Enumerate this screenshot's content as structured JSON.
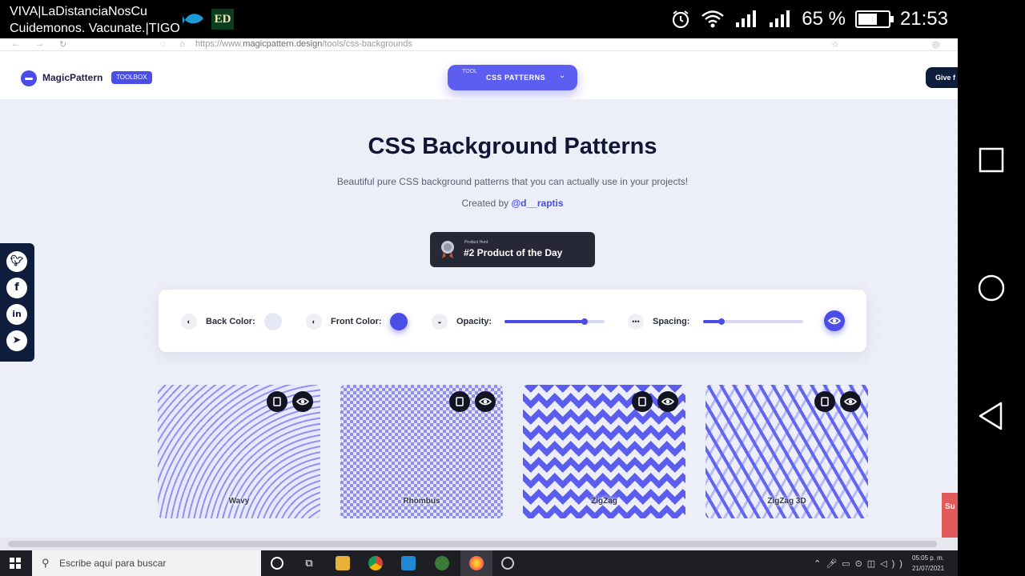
{
  "status_bar": {
    "carrier_line1": "VIVA|LaDistanciaNosCu",
    "carrier_line2": "Cuidemonos. Vacunate.|TIGO",
    "app2_label": "ED",
    "battery_percent": "65 %",
    "battery_level": 0.65,
    "time": "21:53",
    "icons": [
      "app-fish-icon",
      "app-ed-icon",
      "alarm-icon",
      "wifi-icon",
      "signal-icon",
      "signal-icon",
      "battery-icon"
    ]
  },
  "nav_bar": {
    "icons": [
      "recents-square-icon",
      "home-circle-icon",
      "back-triangle-icon"
    ]
  },
  "browser": {
    "url_prefix": "https://www.",
    "url_domain": "magicpattern.design",
    "url_path": "/tools/css-backgrounds"
  },
  "header": {
    "brand": "MagicPattern",
    "badge": "TOOLBOX",
    "tool_label": "TOOL",
    "tool_value": "CSS PATTERNS",
    "give_button": "Give f"
  },
  "hero": {
    "title": "CSS Background Patterns",
    "subtitle": "Beautiful pure CSS background patterns that you can actually use in your projects!",
    "credit_prefix": "Created by ",
    "credit_handle": "@d__raptis"
  },
  "product_hunt": {
    "small": "Product Hunt",
    "big": "#2 Product of the Day"
  },
  "controls": {
    "back_color_label": "Back Color:",
    "back_color": "#e6e7f5",
    "front_color_label": "Front Color:",
    "front_color": "#4a4de6",
    "opacity_label": "Opacity:",
    "opacity_value": 0.8,
    "spacing_label": "Spacing:",
    "spacing_value": 0.18
  },
  "cards": [
    {
      "name": "Wavy"
    },
    {
      "name": "Rhombus"
    },
    {
      "name": "ZigZag"
    },
    {
      "name": "ZigZag 3D"
    }
  ],
  "social": [
    "twitter-icon",
    "facebook-icon",
    "linkedin-icon",
    "telegram-icon"
  ],
  "side_tab": {
    "label": "Su"
  },
  "taskbar": {
    "search_placeholder": "Escribe aquí para buscar",
    "clock_time": "05:05 p. m.",
    "clock_date": "21/07/2021"
  }
}
